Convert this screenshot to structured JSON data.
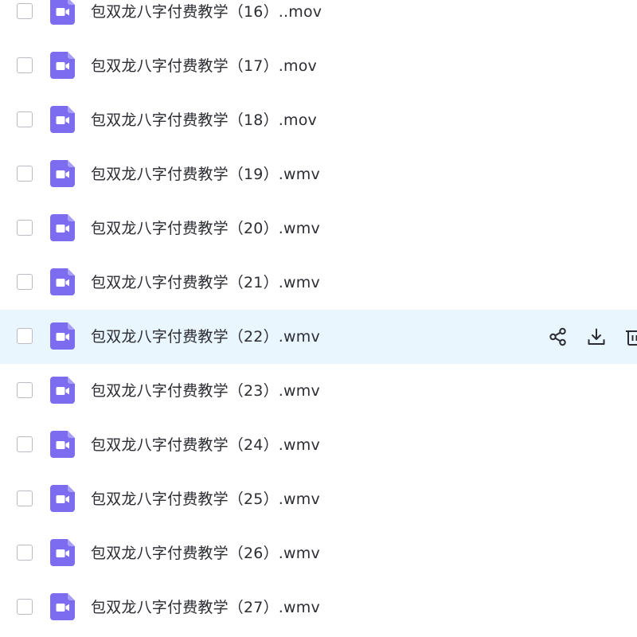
{
  "files": [
    {
      "name": "包双龙八字付费教学（16）..mov",
      "hovered": false
    },
    {
      "name": "包双龙八字付费教学（17）.mov",
      "hovered": false
    },
    {
      "name": "包双龙八字付费教学（18）.mov",
      "hovered": false
    },
    {
      "name": "包双龙八字付费教学（19）.wmv",
      "hovered": false
    },
    {
      "name": "包双龙八字付费教学（20）.wmv",
      "hovered": false
    },
    {
      "name": "包双龙八字付费教学（21）.wmv",
      "hovered": false
    },
    {
      "name": "包双龙八字付费教学（22）.wmv",
      "hovered": true
    },
    {
      "name": "包双龙八字付费教学（23）.wmv",
      "hovered": false
    },
    {
      "name": "包双龙八字付费教学（24）.wmv",
      "hovered": false
    },
    {
      "name": "包双龙八字付费教学（25）.wmv",
      "hovered": false
    },
    {
      "name": "包双龙八字付费教学（26）.wmv",
      "hovered": false
    },
    {
      "name": "包双龙八字付费教学（27）.wmv",
      "hovered": false
    }
  ],
  "file_icon": "video-file-icon",
  "row_actions": [
    {
      "icon": "share-icon"
    },
    {
      "icon": "download-icon"
    },
    {
      "icon": "delete-icon"
    }
  ],
  "colors": {
    "file_icon": "#7b6cf0",
    "hover_row": "#eaf6fd",
    "text": "#2b2d33",
    "checkbox_border": "#b9bcc3"
  }
}
